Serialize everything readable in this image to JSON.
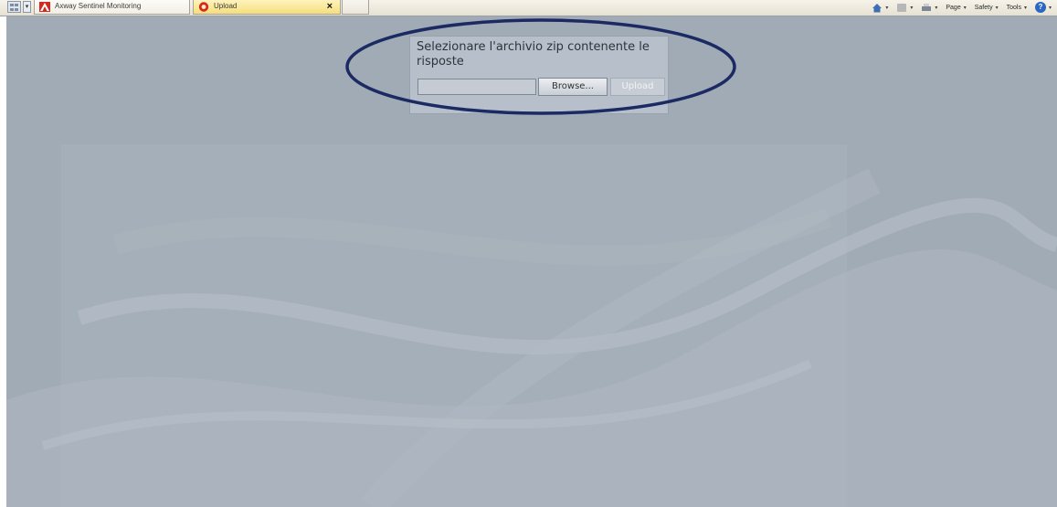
{
  "tabs": [
    {
      "label": "Axway Sentinel Monitoring",
      "icon": "axway-favicon-icon"
    },
    {
      "label": "Upload",
      "icon": "upload-favicon-icon",
      "active": true,
      "close_glyph": "×"
    }
  ],
  "command_bar": {
    "page_label": "Page",
    "safety_label": "Safety",
    "tools_label": "Tools",
    "help_glyph": "?"
  },
  "upload_form": {
    "prompt": "Selezionare l'archivio zip contenente le risposte",
    "file_value": "",
    "browse_label": "Browse...",
    "upload_label": "Upload",
    "upload_enabled": false
  },
  "annotation": {
    "shape": "ellipse",
    "color": "#1c2a63"
  },
  "colors": {
    "page_background": "#a1abb6",
    "active_tab": "#f6de7c",
    "panel_background": "#b7c0ca"
  }
}
